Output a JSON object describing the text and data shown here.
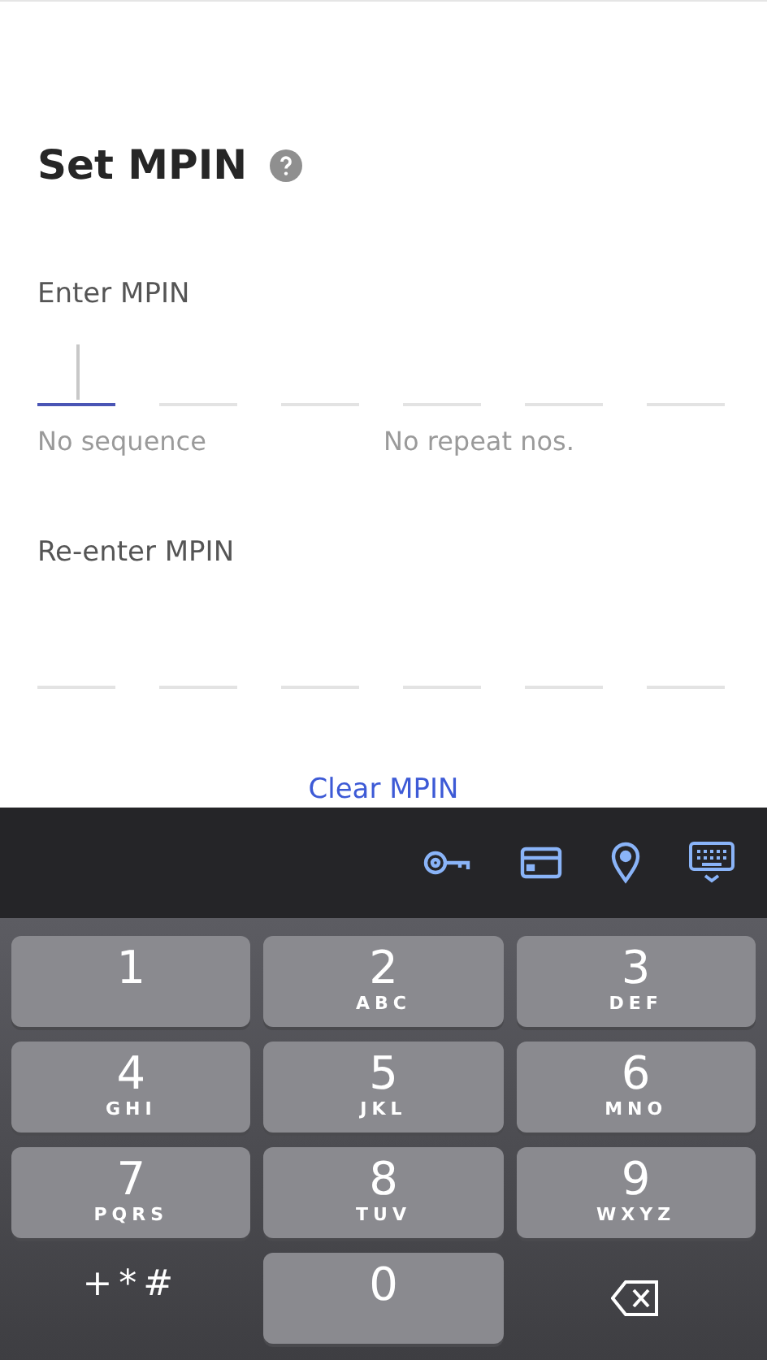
{
  "title": "Set MPIN",
  "enter": {
    "label": "Enter MPIN",
    "slots": [
      {
        "selected": true
      },
      {
        "selected": false
      },
      {
        "selected": false
      },
      {
        "selected": false
      },
      {
        "selected": false
      },
      {
        "selected": false
      }
    ],
    "hints": [
      "No sequence",
      "No repeat nos."
    ]
  },
  "reenter": {
    "label": "Re-enter MPIN",
    "slots": [
      {
        "selected": false
      },
      {
        "selected": false
      },
      {
        "selected": false
      },
      {
        "selected": false
      },
      {
        "selected": false
      },
      {
        "selected": false
      }
    ]
  },
  "clear_link": "Clear MPIN",
  "toolbar": [
    {
      "kind": "key"
    },
    {
      "kind": "card"
    },
    {
      "kind": "location"
    },
    {
      "kind": "keyboard"
    }
  ],
  "keys": [
    {
      "kind": "digit",
      "label": "1"
    },
    {
      "kind": "digit",
      "label": "2",
      "letters": "ABC"
    },
    {
      "kind": "digit",
      "label": "3",
      "letters": "DEF"
    },
    {
      "kind": "digit",
      "label": "4",
      "letters": "GHI"
    },
    {
      "kind": "digit",
      "label": "5",
      "letters": "JKL"
    },
    {
      "kind": "digit",
      "label": "6",
      "letters": "MNO"
    },
    {
      "kind": "digit",
      "label": "7",
      "letters": "PQRS"
    },
    {
      "kind": "digit",
      "label": "8",
      "letters": "TUV"
    },
    {
      "kind": "digit",
      "label": "9",
      "letters": "WXYZ"
    },
    {
      "kind": "symbols",
      "label": "+*#"
    },
    {
      "kind": "digit",
      "label": "0"
    },
    {
      "kind": "backspace"
    }
  ]
}
